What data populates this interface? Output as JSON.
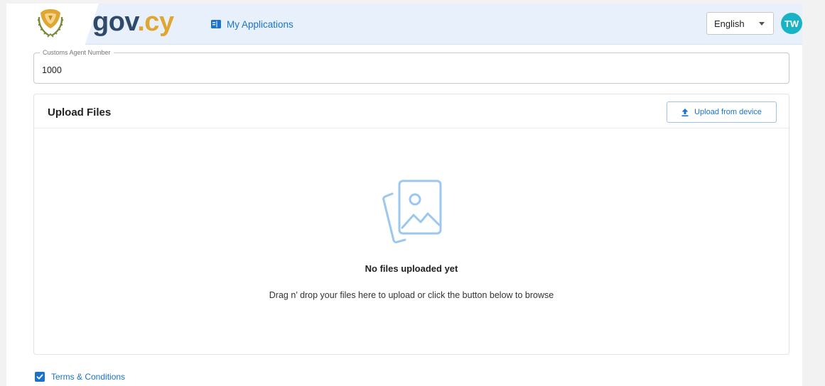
{
  "header": {
    "brand_gov": "gov",
    "brand_cy": ".cy",
    "nav_link": "My Applications",
    "language": "English",
    "avatar_initials": "TW",
    "icons": {
      "emblem": "cyprus-emblem-icon",
      "nav": "book-icon",
      "language_caret": "chevron-down-icon"
    }
  },
  "customs_agent": {
    "label": "Customs Agent Number",
    "value": "1000"
  },
  "upload": {
    "title": "Upload Files",
    "button_label": "Upload from device",
    "empty_title": "No files uploaded yet",
    "empty_description": "Drag n’ drop your files here to upload or click the button below to browse",
    "icons": {
      "button": "upload-icon",
      "empty": "photos-placeholder-icon"
    }
  },
  "terms": {
    "label": "Terms & Conditions",
    "checked": true
  },
  "colors": {
    "accent": "#1a73c8",
    "brand_gov": "#2f4a6b",
    "brand_cy": "#e0a632",
    "avatar": "#1ab3c6",
    "header_bg": "#e8f1fb"
  }
}
